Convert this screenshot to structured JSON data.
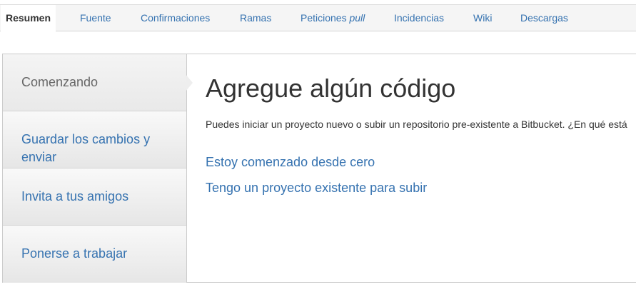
{
  "tabs": [
    {
      "label": "Resumen",
      "active": true
    },
    {
      "label": "Fuente"
    },
    {
      "label": "Confirmaciones"
    },
    {
      "label": "Ramas"
    },
    {
      "label_prefix": "Peticiones ",
      "label_em": "pull"
    },
    {
      "label": "Incidencias"
    },
    {
      "label": "Wiki"
    },
    {
      "label": "Descargas"
    }
  ],
  "sidebar": {
    "items": [
      {
        "label": "Comenzando",
        "active": true
      },
      {
        "label": "Guardar los cambios y enviar"
      },
      {
        "label": "Invita a tus amigos"
      },
      {
        "label": "Ponerse a trabajar"
      }
    ]
  },
  "main": {
    "title": "Agregue algún código",
    "intro": "Puedes iniciar un proyecto nuevo o subir un repositorio pre-existente a Bitbucket. ¿En qué está",
    "options": [
      "Estoy comenzado desde cero",
      "Tengo un proyecto existente para subir"
    ]
  },
  "colors": {
    "link": "#3572b0",
    "text": "#333333",
    "muted": "#666666",
    "border": "#cccccc"
  }
}
